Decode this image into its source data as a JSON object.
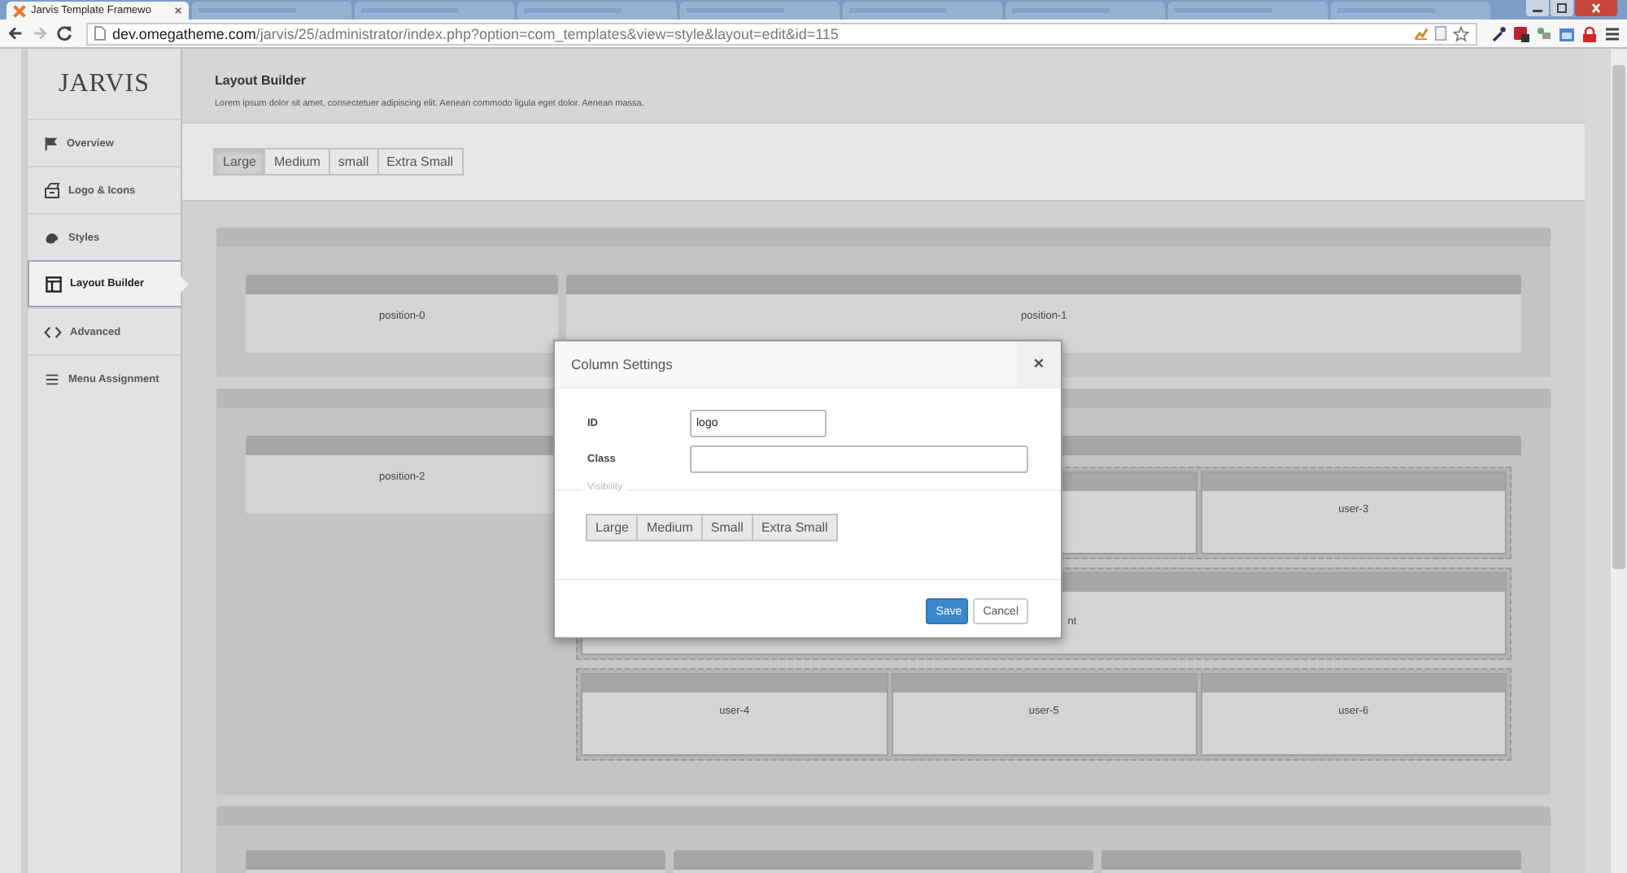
{
  "browser": {
    "tabs": [
      {
        "title": "Jarvis Template Framewo",
        "selected": true
      },
      {
        "selected": false
      },
      {
        "selected": false
      },
      {
        "selected": false
      },
      {
        "selected": false
      },
      {
        "selected": false
      },
      {
        "selected": false
      },
      {
        "selected": false
      },
      {
        "selected": false
      }
    ],
    "url_host": "dev.omegatheme.com",
    "url_path": "/jarvis/25/administrator/index.php?option=com_templates&view=style&layout=edit&id=115"
  },
  "sidebar": {
    "logo": "JARVIS",
    "items": [
      {
        "label": "Overview",
        "selected": false
      },
      {
        "label": "Logo & Icons",
        "selected": false
      },
      {
        "label": "Styles",
        "selected": false
      },
      {
        "label": "Layout Builder",
        "selected": true
      },
      {
        "label": "Advanced",
        "selected": false
      },
      {
        "label": "Menu Assignment",
        "selected": false
      }
    ]
  },
  "header": {
    "title": "Layout Builder",
    "description": "Lorem ipsum dolor sit amet, consectetuer adipiscing elit. Aenean commodo ligula eget dolor. Aenean massa."
  },
  "size_tabs": [
    {
      "label": "Large",
      "selected": true
    },
    {
      "label": "Medium",
      "selected": false
    },
    {
      "label": "small",
      "selected": false
    },
    {
      "label": "Extra Small",
      "selected": false
    }
  ],
  "sections": [
    {
      "kind": "split",
      "columns": [
        {
          "label": "position-0"
        },
        {
          "label": "position-1"
        }
      ]
    },
    {
      "kind": "split",
      "columns": [
        {
          "label": "position-2"
        },
        {
          "rows": [
            {
              "columns": [
                {},
                {
                  "label": "user-3"
                }
              ]
            },
            {
              "columns": [
                {
                  "label": "nt"
                }
              ]
            },
            {
              "columns": [
                {
                  "label": "user-4"
                },
                {
                  "label": "user-5"
                },
                {
                  "label": "user-6"
                }
              ]
            }
          ]
        }
      ]
    },
    {
      "kind": "thirds",
      "columns": [
        {},
        {},
        {}
      ]
    }
  ],
  "modal": {
    "title": "Column Settings",
    "close": "×",
    "fields": [
      {
        "label": "ID",
        "value": "logo",
        "kind": "short"
      },
      {
        "label": "Class",
        "kind": "wide"
      }
    ],
    "legend": "Visibility",
    "visibility": [
      {
        "label": "Large",
        "selected": false
      },
      {
        "label": "Medium",
        "selected": false
      },
      {
        "label": "Small",
        "selected": false
      },
      {
        "label": "Extra Small",
        "selected": false
      }
    ],
    "buttons": [
      {
        "label": "Save",
        "kind": "primary"
      },
      {
        "label": "Cancel",
        "kind": "default"
      }
    ]
  }
}
